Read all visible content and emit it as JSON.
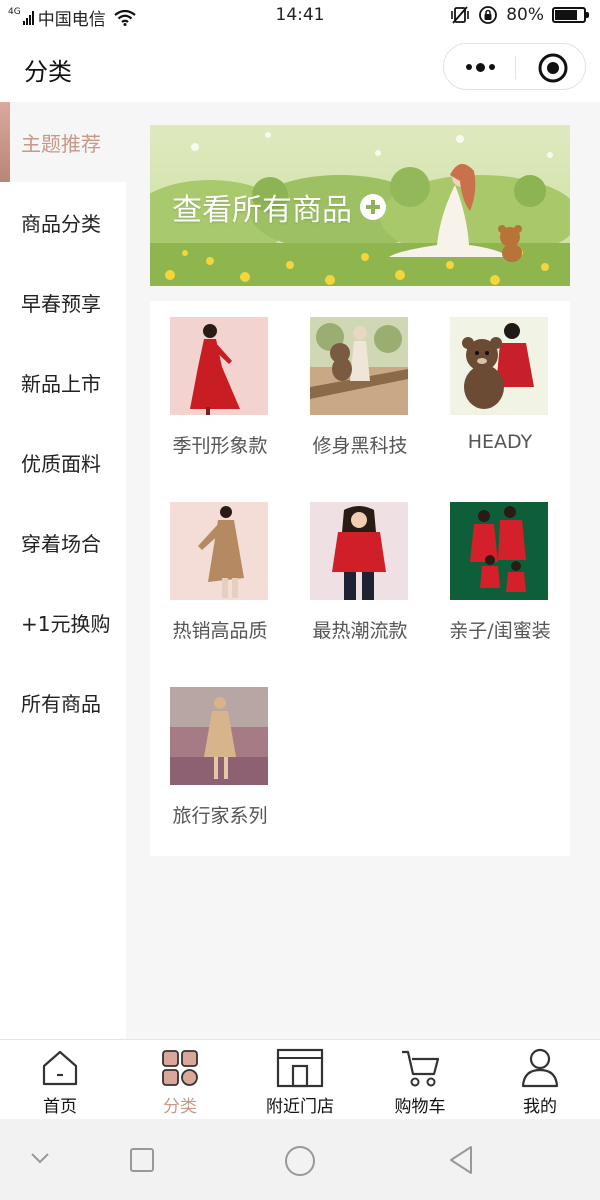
{
  "status_bar": {
    "network": "4G",
    "carrier": "中国电信",
    "time": "14:41",
    "battery": "80%",
    "battery_level": 0.8
  },
  "navbar": {
    "title": "分类"
  },
  "sidebar": {
    "items": [
      {
        "label": "主题推荐",
        "active": true
      },
      {
        "label": "商品分类",
        "active": false
      },
      {
        "label": "早春预享",
        "active": false
      },
      {
        "label": "新品上市",
        "active": false
      },
      {
        "label": "优质面料",
        "active": false
      },
      {
        "label": "穿着场合",
        "active": false
      },
      {
        "label": "+1元换购",
        "active": false
      },
      {
        "label": "所有商品",
        "active": false
      }
    ]
  },
  "banner": {
    "text": "查看所有商品"
  },
  "categories": [
    {
      "label": "季刊形象款",
      "thumb": "woman-red-dress"
    },
    {
      "label": "修身黑科技",
      "thumb": "woman-with-teddy-outdoor"
    },
    {
      "label": "HEADY",
      "thumb": "woman-with-teddy-red-top"
    },
    {
      "label": "热销高品质",
      "thumb": "woman-camel-coat"
    },
    {
      "label": "最热潮流款",
      "thumb": "woman-red-cardigan"
    },
    {
      "label": "亲子/闺蜜装",
      "thumb": "family-red-outfits"
    },
    {
      "label": "旅行家系列",
      "thumb": "woman-trench-beach"
    }
  ],
  "tabbar": {
    "items": [
      {
        "label": "首页",
        "icon": "home-icon",
        "active": false
      },
      {
        "label": "分类",
        "icon": "category-icon",
        "active": true
      },
      {
        "label": "附近门店",
        "icon": "store-icon",
        "active": false
      },
      {
        "label": "购物车",
        "icon": "cart-icon",
        "active": false
      },
      {
        "label": "我的",
        "icon": "profile-icon",
        "active": false
      }
    ]
  },
  "colors": {
    "accent": "#c8988a",
    "page_bg": "#f6f6f6"
  }
}
